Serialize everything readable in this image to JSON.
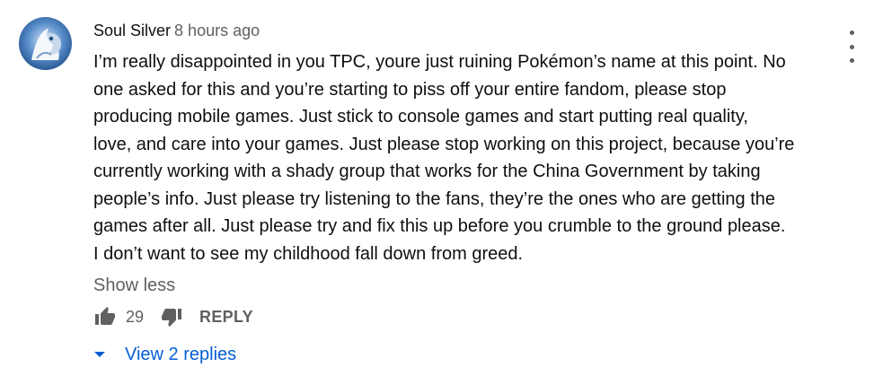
{
  "comment": {
    "author": "Soul Silver",
    "timestamp": "8 hours ago",
    "text": "I’m really disappointed in you TPC, youre just ruining Pokémon’s name at this point. No\none asked for this and you’re starting to piss off your entire fandom, please stop\nproducing mobile games. Just stick to console games and start putting real quality,\nlove, and care into your games. Just please stop working on this project, because you’re\ncurrently working with a shady group that works for the China Government by taking\npeople’s info. Just please try listening to the fans, they’re the ones who are getting the\ngames after all. Just please try and fix this up before you crumble to the ground please.\nI don’t want to see my childhood fall down from greed.",
    "show_less_label": "Show less",
    "like_count": "29",
    "reply_label": "REPLY",
    "view_replies_label": "View 2 replies"
  },
  "icons": {
    "like": "thumbs-up-icon",
    "dislike": "thumbs-down-icon",
    "expand": "caret-down-icon",
    "menu": "more-vert-icon"
  },
  "colors": {
    "link": "#065fd4",
    "secondary_text": "#606060",
    "primary_text": "#0f0f0f",
    "avatar_bg": "#3b6fa8"
  }
}
